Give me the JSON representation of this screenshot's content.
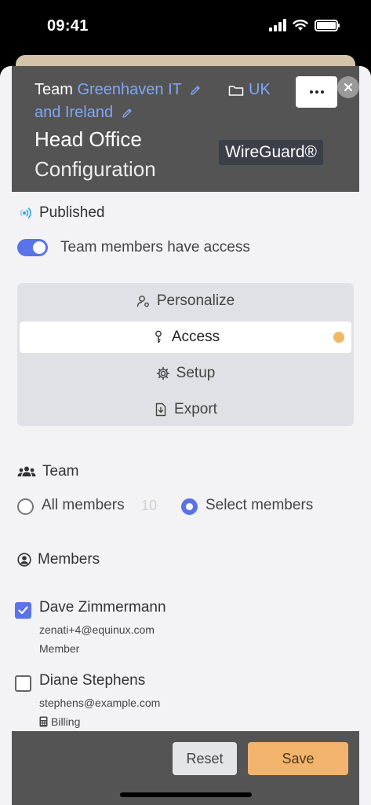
{
  "status_bar": {
    "time": "09:41"
  },
  "header": {
    "team_prefix": "Team",
    "team_name_line1": "Greenhaven IT",
    "team_name_line2": "and Ireland",
    "folder_label": "UK",
    "title_line1": "Head Office",
    "title_line2": "Configuration",
    "protocol_badge": "WireGuard®"
  },
  "status": {
    "published_label": "Published",
    "toggle_label": "Team members have access",
    "toggle_on": true
  },
  "menu": {
    "items": [
      {
        "label": "Personalize",
        "icon": "user-gear-icon"
      },
      {
        "label": "Access",
        "icon": "key-icon",
        "active": true
      },
      {
        "label": "Setup",
        "icon": "gear-icon"
      },
      {
        "label": "Export",
        "icon": "export-file-icon"
      }
    ]
  },
  "team_section": {
    "label": "Team",
    "options": [
      {
        "label": "All members",
        "count": "10",
        "selected": false
      },
      {
        "label": "Select members",
        "selected": true
      }
    ]
  },
  "members_section": {
    "label": "Members",
    "members": [
      {
        "name": "Dave Zimmermann",
        "email": "zenati+4@equinux.com",
        "role": "Member",
        "checked": true
      },
      {
        "name": "Diane Stephens",
        "email": "stephens@example.com",
        "role": "Billing",
        "checked": false,
        "role_icon": "calculator-icon"
      }
    ]
  },
  "footer": {
    "reset_label": "Reset",
    "save_label": "Save"
  },
  "colors": {
    "accent": "#5b73e8",
    "link": "#7fa7f5",
    "save": "#f2b46c",
    "header_bg": "#545454",
    "indicator": "#f0b765"
  }
}
